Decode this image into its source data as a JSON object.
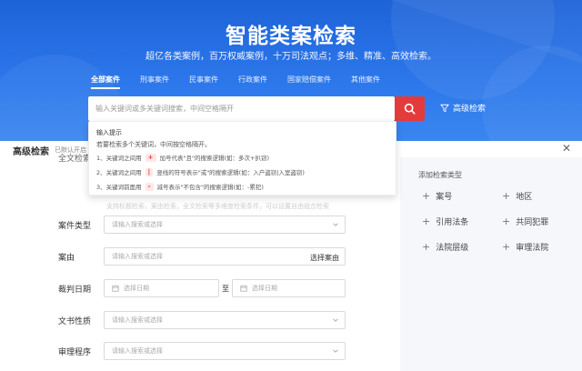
{
  "hero": {
    "title": "智能类案检索",
    "subtitle": "超亿各类案例，百万权威案例，十万司法观点；多维、精准、高效检索。",
    "tabs": [
      {
        "label": "全部案件",
        "active": true
      },
      {
        "label": "刑事案件",
        "active": false
      },
      {
        "label": "民事案件",
        "active": false
      },
      {
        "label": "行政案件",
        "active": false
      },
      {
        "label": "国家赔偿案件",
        "active": false
      },
      {
        "label": "其他案件",
        "active": false
      }
    ]
  },
  "search": {
    "placeholder": "输入关键词或多关键词搜索，中间空格隔开",
    "button_icon": "search-icon",
    "advanced_label": "高级检索",
    "advanced_icon": "filter-icon"
  },
  "dropdown": {
    "title": "输入提示",
    "description": "若要检索多个关键词，中间按空格隔开。",
    "rules": [
      {
        "prefix": "1、关键词之间用",
        "symbol": "+",
        "suffix": "加号代表\"且\"的搜索逻辑(如：多次+扒窃)"
      },
      {
        "prefix": "2、关键词之间用",
        "symbol": "|",
        "suffix": "竖线的符号表示\"或\"的搜索逻辑(如：入户盗窃|入室盗窃)"
      },
      {
        "prefix": "3、关键词前面用",
        "symbol": "-",
        "suffix": "减号表示\"不包含\"的搜索逻辑(如：-累犯)"
      }
    ]
  },
  "panel": {
    "title": "高级检索",
    "note": "已默认开启",
    "close_icon": "close-icon",
    "obscured_label": "全文检索",
    "faded_hint": "支持标题检索，案由检索，全文检索等多维度检索条件，可以设置自由组合检索",
    "fields": {
      "case_type": {
        "label": "案件类型",
        "placeholder": "请输入搜索或选择"
      },
      "cause": {
        "label": "案由",
        "placeholder": "请输入搜索或选择",
        "action": "选择案由"
      },
      "judgment_date": {
        "label": "裁判日期",
        "start_placeholder": "选择日期",
        "separator": "至",
        "end_placeholder": "选择日期"
      },
      "doc_nature": {
        "label": "文书性质",
        "placeholder": "请输入搜索或选择"
      },
      "procedure": {
        "label": "审理程序",
        "placeholder": "请输入搜索或选择"
      }
    },
    "add_types": {
      "title": "添加检索类型",
      "items": [
        "案号",
        "地区",
        "引用法条",
        "共同犯罪",
        "法院层级",
        "审理法院"
      ]
    }
  }
}
